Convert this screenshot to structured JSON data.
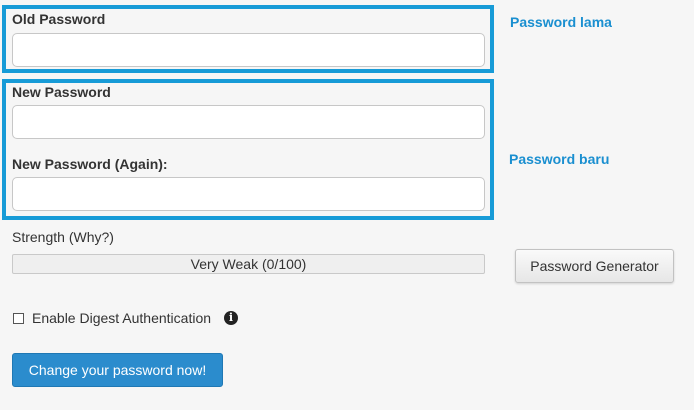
{
  "old_password": {
    "label": "Old Password",
    "value": "",
    "annotation": "Password lama"
  },
  "new_password": {
    "label": "New Password",
    "value": "",
    "again_label": "New Password (Again):",
    "again_value": "",
    "annotation": "Password baru"
  },
  "strength": {
    "label": "Strength (Why?)",
    "value_text": "Very Weak (0/100)",
    "score": 0,
    "max": 100
  },
  "generator_button": "Password Generator",
  "digest": {
    "label": "Enable Digest Authentication",
    "checked": false,
    "info_icon": "info-circle-icon"
  },
  "submit_button": "Change your password now!",
  "colors": {
    "highlight": "#179bd7",
    "annotation": "#1a8fd0",
    "primary": "#2b8ccd"
  }
}
